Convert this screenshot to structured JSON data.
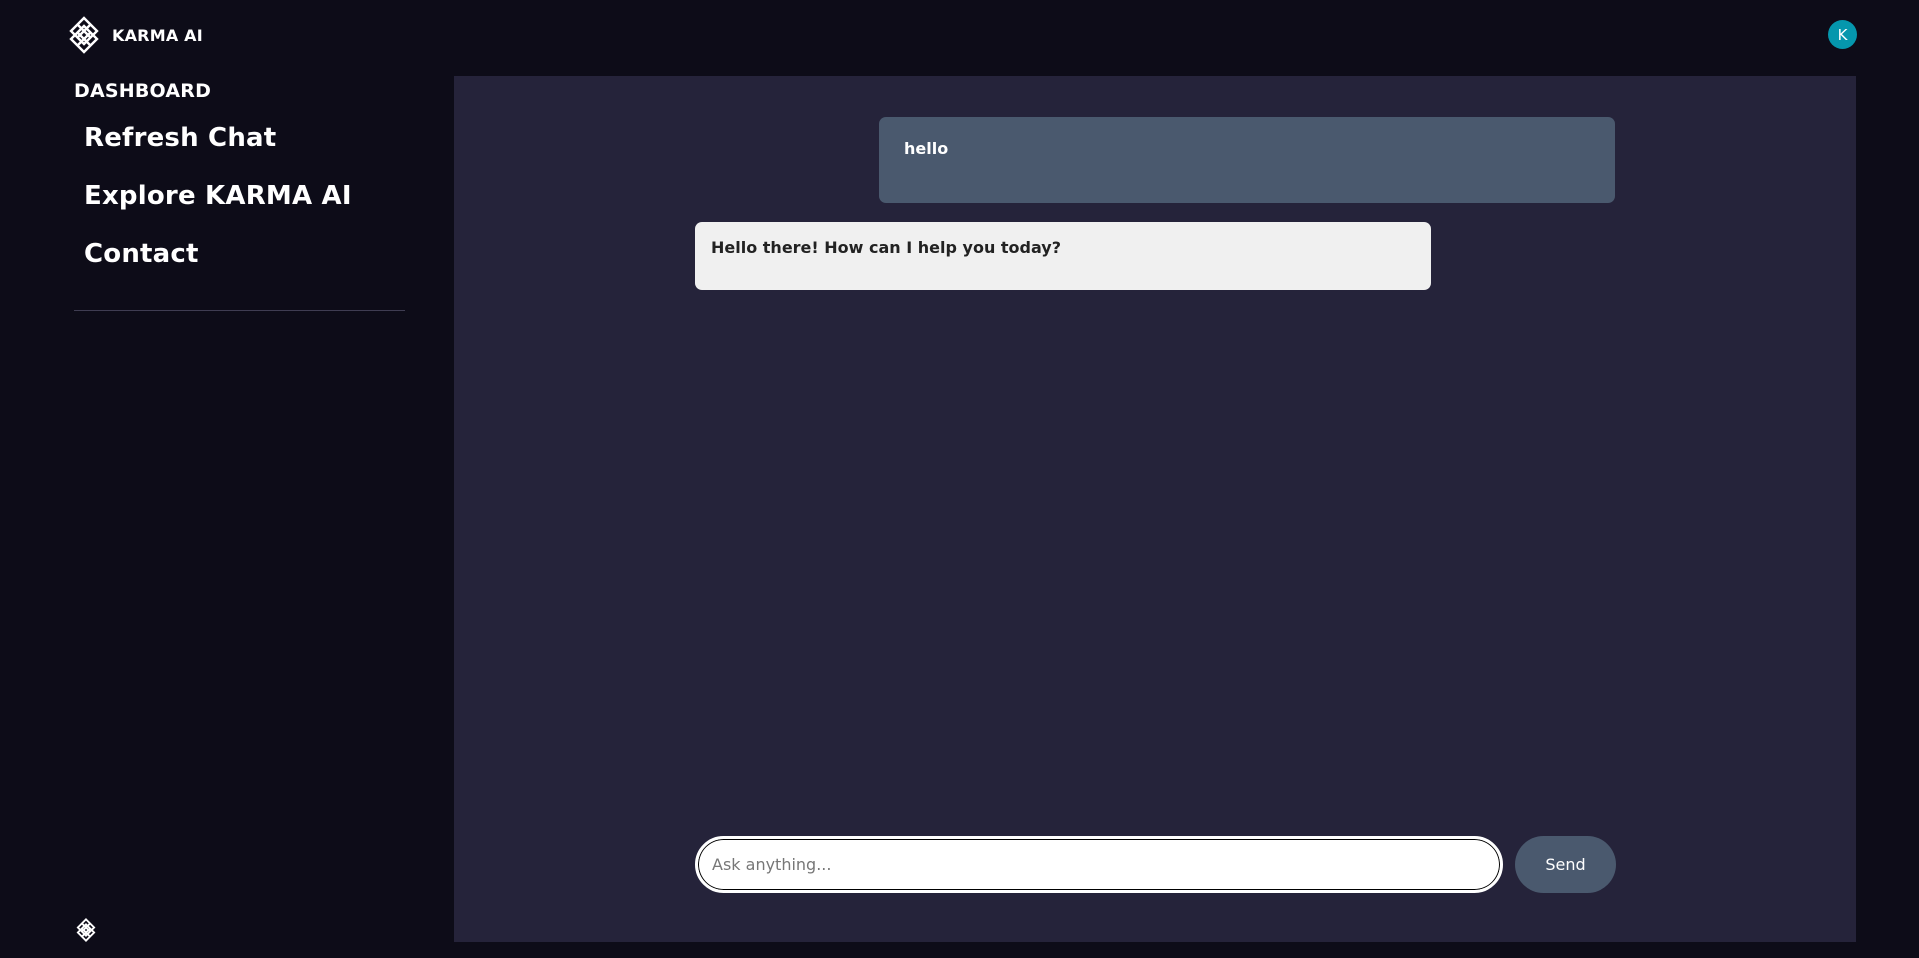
{
  "header": {
    "brand": "KARMA AI",
    "brand_icon": "endless-knot-logo-icon",
    "avatar_letter": "K"
  },
  "sidebar": {
    "title": "DASHBOARD",
    "items": [
      {
        "label": "Refresh Chat"
      },
      {
        "label": "Explore KARMA AI"
      },
      {
        "label": "Contact"
      }
    ],
    "bottom_icon": "endless-knot-icon"
  },
  "chat": {
    "messages": [
      {
        "role": "user",
        "text": "hello"
      },
      {
        "role": "assistant",
        "text": "Hello there! How can I help you today?"
      }
    ],
    "input": {
      "value": "",
      "placeholder": "Ask anything..."
    },
    "send_label": "Send"
  },
  "colors": {
    "page_background": "#0d0c18",
    "panel_background": "#25233a",
    "user_bubble": "#4a596e",
    "assistant_bubble": "#f0f0f0",
    "avatar": "#0597ad",
    "send_button": "#4a596e"
  }
}
